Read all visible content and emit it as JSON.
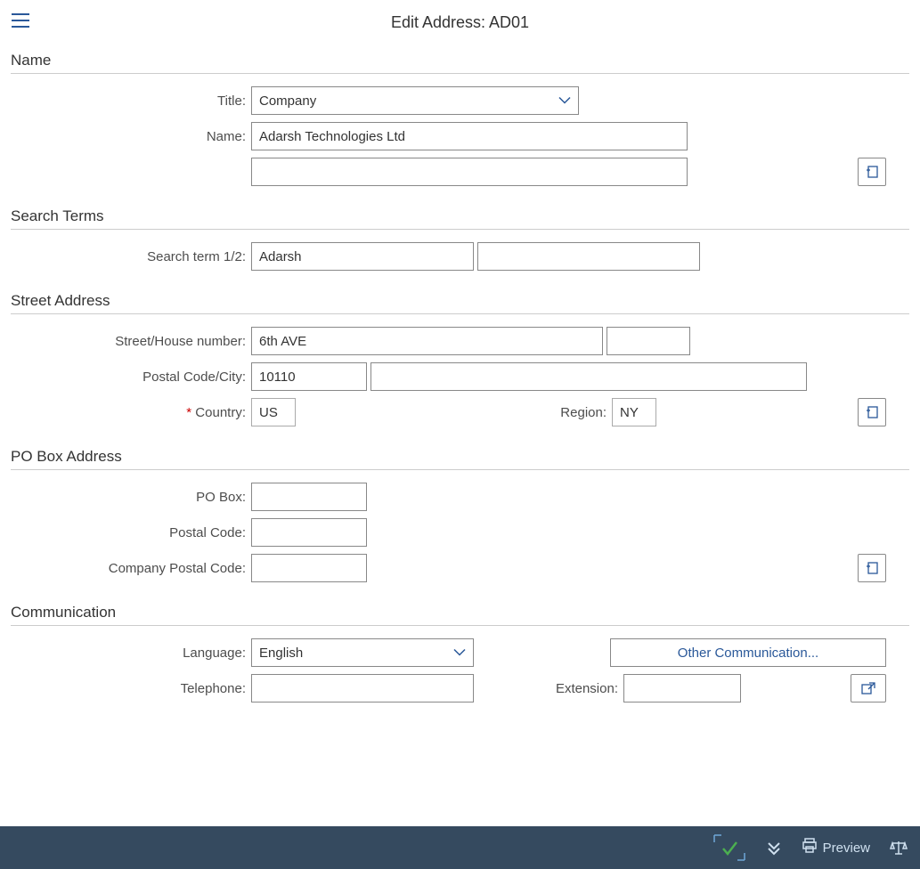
{
  "header": {
    "title": "Edit Address:  AD01"
  },
  "sections": {
    "name": {
      "title": "Name"
    },
    "search": {
      "title": "Search Terms"
    },
    "street": {
      "title": "Street Address"
    },
    "pobox": {
      "title": "PO Box Address"
    },
    "comm": {
      "title": "Communication"
    }
  },
  "labels": {
    "title": "Title:",
    "name": "Name:",
    "search_term": "Search term 1/2:",
    "street_house": "Street/House number:",
    "postal_city": "Postal Code/City:",
    "country": "Country:",
    "region": "Region:",
    "po_box": "PO Box:",
    "po_postal": "Postal Code:",
    "company_postal": "Company Postal Code:",
    "language": "Language:",
    "telephone": "Telephone:",
    "extension": "Extension:"
  },
  "values": {
    "title": "Company",
    "name1": "Adarsh Technologies Ltd",
    "name2": "",
    "search1": "Adarsh",
    "search2": "",
    "street": "6th AVE",
    "house": "",
    "postal": "10110",
    "city": "",
    "country": "US",
    "region": "NY",
    "po_box": "",
    "po_postal": "",
    "company_postal": "",
    "language": "English",
    "telephone": "",
    "extension": ""
  },
  "buttons": {
    "other_comm": "Other Communication..."
  },
  "footer": {
    "preview": "Preview"
  }
}
